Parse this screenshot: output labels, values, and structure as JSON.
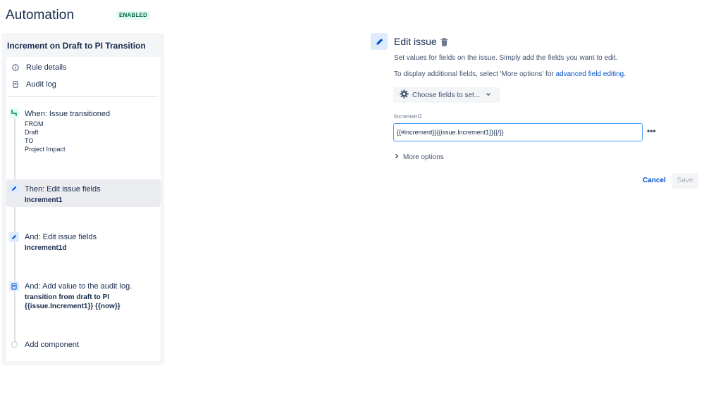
{
  "header": {
    "title": "Automation",
    "status_badge": "ENABLED"
  },
  "rule": {
    "name": "Increment on Draft to PI Transition",
    "nav": [
      {
        "label": "Rule details",
        "icon": "info-icon"
      },
      {
        "label": "Audit log",
        "icon": "document-icon"
      }
    ],
    "trigger": {
      "title": "When: Issue transitioned",
      "from_label": "FROM",
      "from_value": "Draft",
      "to_label": "TO",
      "to_value": "Project Impact"
    },
    "components": [
      {
        "title": "Then: Edit issue fields",
        "detail": "Increment1",
        "selected": true
      },
      {
        "title": "And: Edit issue fields",
        "detail": "Increment1d",
        "selected": false
      },
      {
        "title": "And: Add value to the audit log.",
        "detail_line1": "transition from draft to PI",
        "detail_line2": "{{issue.Increment1}} {{now}}",
        "selected": false
      }
    ],
    "add_component": "Add component"
  },
  "editor": {
    "title": "Edit issue",
    "desc1": "Set values for fields on the issue. Simply add the fields you want to edit.",
    "desc2_prefix": "To display additional fields, select 'More options' for ",
    "desc2_link": "advanced field editing",
    "desc2_suffix": ".",
    "choose_fields": "Choose fields to set...",
    "field_label": "Increment1",
    "field_value": "{{#increment}}{{issue.Increment1}}{{/}}",
    "more_dots": "•••",
    "more_options": "More options",
    "cancel": "Cancel",
    "save": "Save"
  },
  "colors": {
    "accent": "#0052cc",
    "selected_bg": "#ebecf0",
    "badge_bg": "#e3fcef",
    "badge_text": "#006644"
  }
}
